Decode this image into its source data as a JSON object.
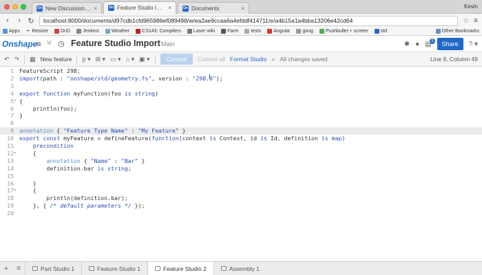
{
  "browser": {
    "tabs": [
      {
        "title": "New Discussion - Onshape",
        "active": false
      },
      {
        "title": "Feature Studio Import | Fea",
        "active": true
      },
      {
        "title": "Documents",
        "active": false
      }
    ],
    "user": "Kevin",
    "url": "localhost:8000/documents/d97cdb1cfd965986ef089498/w/ea2ae9ccaa6a4efddf414711/e/a4b15a1a4bba13206e42cd64",
    "bookmarks": [
      "Apps",
      "+- Resizer",
      "DnD",
      "Jenkins",
      "Weather",
      "CS143: Compilers",
      "Laser wiki",
      "Farm",
      "tests",
      "Angular",
      "goog",
      "Pushbullet + screen",
      "std"
    ],
    "other_bookmarks": "Other Bookmarks"
  },
  "app": {
    "logo": "Onshape",
    "doc_title": "Feature Studio Import",
    "workspace": "Main",
    "share_label": "Share",
    "notification_count": "1",
    "help_label": "?"
  },
  "toolbar": {
    "new_feature": "New feature",
    "commit": "Commit",
    "commit_all": "Commit all",
    "format": "Format Studio",
    "status": "All changes saved.",
    "position": "Line 9, Column 49"
  },
  "editor": {
    "lines": [
      {
        "n": "1",
        "fold": "",
        "html": "FeatureScript 298;"
      },
      {
        "n": "2",
        "fold": "",
        "html": "<span class=\"kw\">import</span>(path : <span class=\"str\">\"onshape/std/geometry.fs\"</span>, version : <span class=\"str\">\"298.0\"</span>);"
      },
      {
        "n": "3",
        "fold": "",
        "html": ""
      },
      {
        "n": "4",
        "fold": "",
        "html": "<span class=\"kw\">export function</span> myFunction(foo <span class=\"kw\">is</span> <span class=\"kw\">string</span>)"
      },
      {
        "n": "5",
        "fold": "▾",
        "html": "{"
      },
      {
        "n": "6",
        "fold": "",
        "html": "    println(foo);"
      },
      {
        "n": "7",
        "fold": "",
        "html": "}"
      },
      {
        "n": "8",
        "fold": "",
        "html": ""
      },
      {
        "n": "9",
        "fold": "",
        "html": "<span class=\"anno\">annotation</span> { <span class=\"str\">\"Feature Type Name\"</span> : <span class=\"str\">\"My Feature\"</span> }"
      },
      {
        "n": "10",
        "fold": "",
        "html": "<span class=\"kw\">export const</span> myFeature = defineFeature(<span class=\"kw\">function</span>(context <span class=\"kw\">is</span> Context, id <span class=\"kw\">is</span> Id, definition <span class=\"kw\">is</span> <span class=\"kw\">map</span>)"
      },
      {
        "n": "11",
        "fold": "",
        "html": "    <span class=\"kw\">precondition</span>"
      },
      {
        "n": "12",
        "fold": "▾",
        "html": "    {"
      },
      {
        "n": "13",
        "fold": "",
        "html": "        <span class=\"anno\">annotation</span> { <span class=\"str\">\"Name\"</span> : <span class=\"str\">\"Bar\"</span> }"
      },
      {
        "n": "14",
        "fold": "",
        "html": "        definition.bar <span class=\"kw\">is</span> <span class=\"kw\">string</span>;"
      },
      {
        "n": "15",
        "fold": "",
        "html": ""
      },
      {
        "n": "16",
        "fold": "",
        "html": "    }"
      },
      {
        "n": "17",
        "fold": "▾",
        "html": "    {"
      },
      {
        "n": "18",
        "fold": "",
        "html": "        println(definition.bar);"
      },
      {
        "n": "19",
        "fold": "",
        "html": "    }, { <span class=\"cmt\">/* default parameters */</span> });"
      },
      {
        "n": "20",
        "fold": "",
        "html": ""
      }
    ],
    "active_line": "9"
  },
  "bottom_tabs": [
    {
      "label": "Part Studio 1",
      "active": false
    },
    {
      "label": "Feature Studio 1",
      "active": false
    },
    {
      "label": "Feature Studio 2",
      "active": true
    },
    {
      "label": "Assembly 1",
      "active": false
    }
  ],
  "colors": {
    "brand": "#1e6fc4",
    "share": "#2068c8",
    "keyword": "#2b4fb3",
    "annotation": "#5b8ac9"
  }
}
